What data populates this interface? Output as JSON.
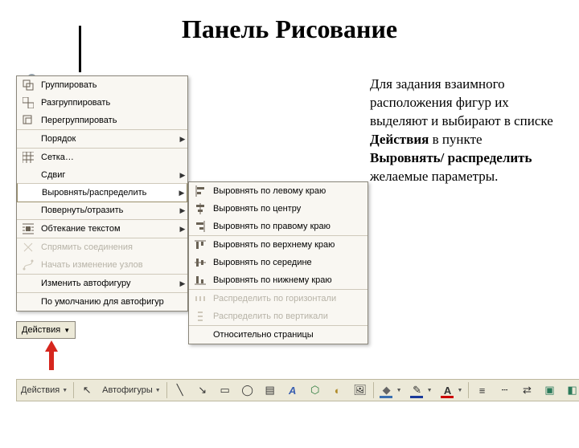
{
  "title": "Панель Рисование",
  "body_parts": {
    "p1": "Для задания взаимного расположения фигур их выделяют и выбирают в списке ",
    "b1": "Действия",
    "p2": " в пункте ",
    "b2": "Выровнять/ распределить",
    "p3": " желаемые параметры."
  },
  "menu1": [
    {
      "icon": "group",
      "label": "Группировать"
    },
    {
      "icon": "ungroup",
      "label": "Разгруппировать"
    },
    {
      "icon": "regroup",
      "label": "Перегруппировать"
    },
    {
      "icon": "",
      "label": "Порядок",
      "arrow": true,
      "sep": true
    },
    {
      "icon": "grid",
      "label": "Сетка…",
      "sep": true
    },
    {
      "icon": "",
      "label": "Сдвиг",
      "arrow": true
    },
    {
      "icon": "",
      "label": "Выровнять/распределить",
      "arrow": true,
      "sel": true,
      "sep": true
    },
    {
      "icon": "",
      "label": "Повернуть/отразить",
      "arrow": true
    },
    {
      "icon": "wrap",
      "label": "Обтекание текстом",
      "arrow": true,
      "sep": true
    },
    {
      "icon": "reroute",
      "label": "Спрямить соединения",
      "dis": true,
      "sep": true
    },
    {
      "icon": "edit",
      "label": "Начать изменение узлов",
      "dis": true
    },
    {
      "icon": "",
      "label": "Изменить автофигуру",
      "arrow": true,
      "sep": true
    },
    {
      "icon": "",
      "label": "По умолчанию для автофигур",
      "sep": true
    }
  ],
  "menu2": [
    {
      "icon": "al",
      "label": "Выровнять по левому краю"
    },
    {
      "icon": "ac",
      "label": "Выровнять по центру"
    },
    {
      "icon": "ar",
      "label": "Выровнять по правому краю"
    },
    {
      "icon": "at",
      "label": "Выровнять по верхнему краю",
      "sep": true
    },
    {
      "icon": "am",
      "label": "Выровнять по середине"
    },
    {
      "icon": "ab",
      "label": "Выровнять по нижнему краю"
    },
    {
      "icon": "dh",
      "label": "Распределить по горизонтали",
      "dis": true,
      "sep": true
    },
    {
      "icon": "dv",
      "label": "Распределить по вертикали",
      "dis": true
    },
    {
      "icon": "",
      "label": "Относительно страницы",
      "sep": true
    }
  ],
  "drop_btn": "Действия",
  "toolbar": {
    "actions": "Действия",
    "autoshapes": "Автофигуры"
  }
}
